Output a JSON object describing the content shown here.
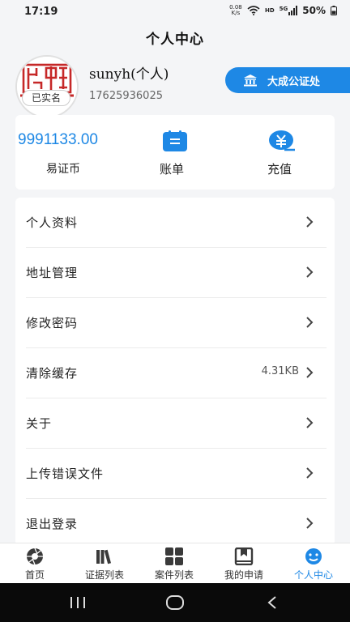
{
  "status_bar": {
    "time": "17:19",
    "net_speed_top": "0.08",
    "net_speed_bottom": "K/s",
    "hd": "HD",
    "signal": "5G",
    "battery": "50%"
  },
  "header": {
    "title": "个人中心"
  },
  "profile": {
    "name": "sunyh(个人)",
    "phone": "17625936025",
    "verified": "已实名",
    "avatar_icon": "seal-stamp-icon"
  },
  "org_button": {
    "label": "大成公证处",
    "icon": "bank-icon"
  },
  "wallet": {
    "balance": "9991133.00",
    "balance_label": "易证币",
    "bill_label": "账单",
    "recharge_label": "充值"
  },
  "menu": {
    "items": [
      {
        "label": "个人资料",
        "value": ""
      },
      {
        "label": "地址管理",
        "value": ""
      },
      {
        "label": "修改密码",
        "value": ""
      },
      {
        "label": "清除缓存",
        "value": "4.31KB"
      },
      {
        "label": "关于",
        "value": ""
      },
      {
        "label": "上传错误文件",
        "value": ""
      },
      {
        "label": "退出登录",
        "value": ""
      }
    ]
  },
  "bottom_nav": {
    "items": [
      {
        "label": "首页",
        "icon": "aperture-icon"
      },
      {
        "label": "证据列表",
        "icon": "books-icon"
      },
      {
        "label": "案件列表",
        "icon": "grid-icon"
      },
      {
        "label": "我的申请",
        "icon": "bookmark-book-icon"
      },
      {
        "label": "个人中心",
        "icon": "smile-face-icon"
      }
    ],
    "active": "个人中心"
  },
  "colors": {
    "accent": "#1e88e5",
    "background": "#f4f5f7"
  }
}
